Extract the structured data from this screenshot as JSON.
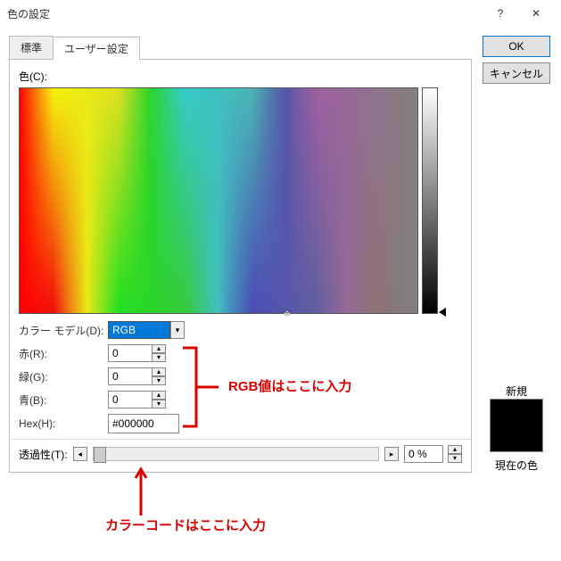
{
  "titlebar": {
    "title": "色の設定",
    "help": "?",
    "close": "✕"
  },
  "tabs": {
    "standard": "標準",
    "custom": "ユーザー設定"
  },
  "labels": {
    "color": "色(C):",
    "model": "カラー モデル(D):",
    "red": "赤(R):",
    "green": "緑(G):",
    "blue": "青(B):",
    "hex": "Hex(H):",
    "transparency": "透過性(T):",
    "new": "新規",
    "current": "現在の色"
  },
  "values": {
    "model": "RGB",
    "red": "0",
    "green": "0",
    "blue": "0",
    "hex": "#000000",
    "transparency": "0 %"
  },
  "buttons": {
    "ok": "OK",
    "cancel": "キャンセル"
  },
  "annotations": {
    "rgb": "RGB値はここに入力",
    "hex": "カラーコードはここに入力"
  },
  "swatch": {
    "new_color": "#000000",
    "current_color": "#000000"
  }
}
